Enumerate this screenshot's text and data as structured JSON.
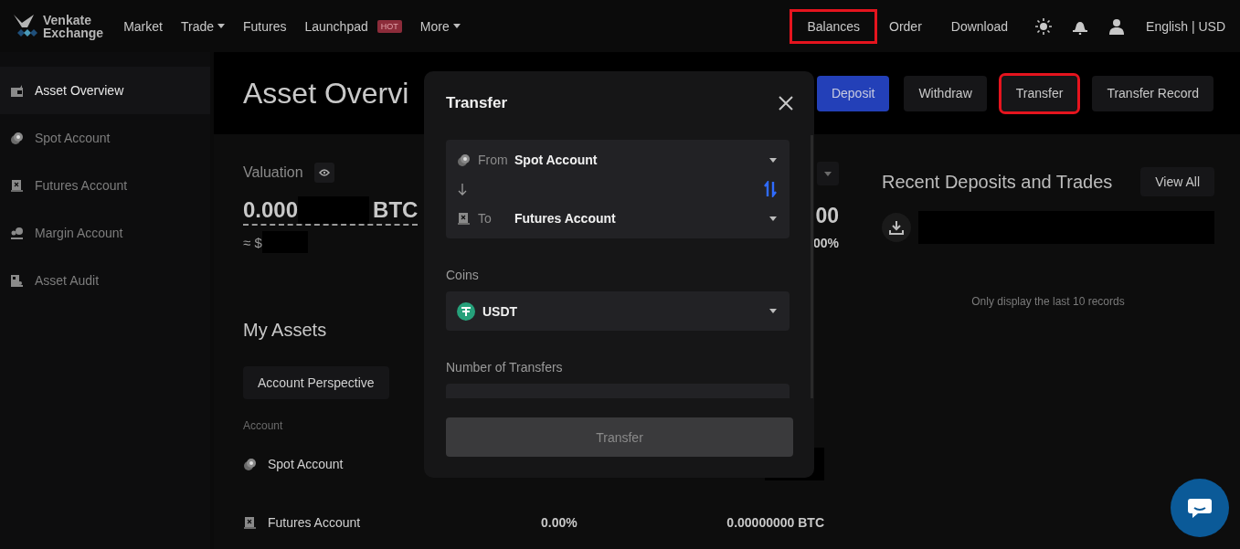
{
  "nav": {
    "logo_lines": [
      "Venkate",
      "Exchange"
    ],
    "items": [
      {
        "label": "Market",
        "dropdown": false
      },
      {
        "label": "Trade",
        "dropdown": true
      },
      {
        "label": "Futures",
        "dropdown": false
      },
      {
        "label": "Launchpad",
        "dropdown": false,
        "badge": "HOT"
      },
      {
        "label": "More",
        "dropdown": true
      }
    ],
    "links": [
      {
        "label": "Balances",
        "highlighted": true
      },
      {
        "label": "Order",
        "highlighted": false
      },
      {
        "label": "Download",
        "highlighted": false
      }
    ],
    "language": "English | USD"
  },
  "sidebar": {
    "items": [
      {
        "label": "Asset Overview",
        "kind": "overview",
        "selected": true
      },
      {
        "label": "Spot Account",
        "kind": "spot",
        "selected": false
      },
      {
        "label": "Futures Account",
        "kind": "futures",
        "selected": false
      },
      {
        "label": "Margin Account",
        "kind": "margin",
        "selected": false
      },
      {
        "label": "Asset Audit",
        "kind": "audit",
        "selected": false
      }
    ]
  },
  "header": {
    "title": "Asset Overvi",
    "buttons": [
      {
        "label": "Deposit",
        "kind": "primary",
        "highlighted": false
      },
      {
        "label": "Withdraw",
        "kind": "secondary",
        "highlighted": false
      },
      {
        "label": "Transfer",
        "kind": "secondary",
        "highlighted": true
      },
      {
        "label": "Transfer Record",
        "kind": "secondary",
        "highlighted": false
      }
    ]
  },
  "valuation": {
    "label": "Valuation",
    "amount": "0.000",
    "unit": "BTC",
    "approx": "≈ $"
  },
  "side_figures": [
    "00",
    "00%"
  ],
  "my_assets": {
    "title": "My Assets",
    "tabs": [
      {
        "label": "Account Perspective",
        "selected": true
      }
    ],
    "columns": [
      "Account"
    ],
    "rows": [
      {
        "account": "Spot Account",
        "kind": "spot"
      },
      {
        "account": "Futures Account",
        "kind": "futures",
        "share": "0.00%",
        "amount": "0.00000000 BTC"
      }
    ]
  },
  "recent": {
    "title": "Recent Deposits and Trades",
    "view_all": "View All",
    "note": "Only display the last 10 records"
  },
  "modal": {
    "title": "Transfer",
    "from": {
      "label": "From",
      "value": "Spot Account",
      "kind": "spot"
    },
    "to": {
      "label": "To",
      "value": "Futures Account",
      "kind": "futures"
    },
    "coins_label": "Coins",
    "coin": "USDT",
    "amount_label": "Number of Transfers",
    "submit": {
      "label": "Transfer",
      "disabled": true
    }
  }
}
